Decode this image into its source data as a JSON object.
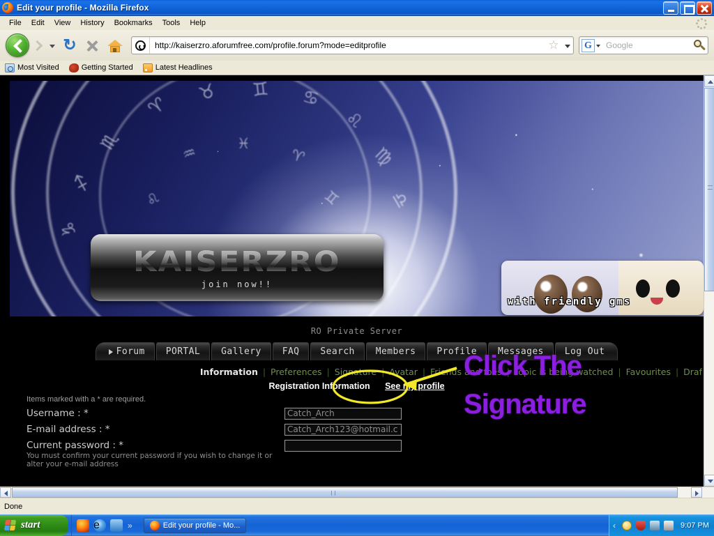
{
  "window": {
    "title": "Edit your profile - Mozilla Firefox",
    "minimize_label": "Minimize",
    "maximize_label": "Restore",
    "close_label": "Close"
  },
  "menubar": {
    "items": [
      {
        "label": "File"
      },
      {
        "label": "Edit"
      },
      {
        "label": "View"
      },
      {
        "label": "History"
      },
      {
        "label": "Bookmarks"
      },
      {
        "label": "Tools"
      },
      {
        "label": "Help"
      }
    ]
  },
  "toolbar": {
    "back_label": "Back",
    "forward_label": "Forward",
    "history_dropdown_label": "Recent pages",
    "reload_glyph": "↻",
    "reload_label": "Reload",
    "stop_label": "Stop",
    "home_label": "Home",
    "url": "http://kaiserzro.aforumfree.com/profile.forum?mode=editprofile",
    "bookmark_star_glyph": "☆",
    "url_dropdown_label": "History dropdown",
    "search_engine_letter": "G",
    "search_placeholder": "Google",
    "search_value": ""
  },
  "bookmarks": {
    "items": [
      {
        "label": "Most Visited",
        "icon": "folder-icon"
      },
      {
        "label": "Getting Started",
        "icon": "dino-icon"
      },
      {
        "label": "Latest Headlines",
        "icon": "rss-icon"
      }
    ]
  },
  "page": {
    "banner": {
      "logo_text": "kaiserzRO",
      "logo_sub": "join now!!",
      "right_banner_text": "with friendly GMs"
    },
    "tagline": "RO Private Server",
    "tabs": [
      {
        "label": "Forum",
        "has_arrow": true
      },
      {
        "label": "PORTAL",
        "has_arrow": false
      },
      {
        "label": "Gallery",
        "has_arrow": false
      },
      {
        "label": "FAQ",
        "has_arrow": false
      },
      {
        "label": "Search",
        "has_arrow": false
      },
      {
        "label": "Members",
        "has_arrow": false
      },
      {
        "label": "Profile",
        "has_arrow": false
      },
      {
        "label": "Messages",
        "has_arrow": false
      },
      {
        "label": "Log Out",
        "has_arrow": false
      }
    ],
    "subnav": {
      "current": "Information",
      "links": [
        "Preferences",
        "Signature",
        "Avatar",
        "Friends and foes",
        "Topic is being watched",
        "Favourites",
        "Draf"
      ],
      "separator": "|"
    },
    "section": {
      "heading": "Registration Information",
      "see_profile_link": "See my profile",
      "required_note": "Items marked with a * are required."
    },
    "form": {
      "fields": [
        {
          "label": "Username : *",
          "sub": "",
          "value": "Catch_Arch",
          "type": "text"
        },
        {
          "label": "E-mail address : *",
          "sub": "",
          "value": "Catch_Arch123@hotmail.c",
          "type": "text"
        },
        {
          "label": "Current password : *",
          "sub": "You must confirm your current password if you wish to change it or alter your e-mail address",
          "value": "",
          "type": "password"
        }
      ]
    },
    "annotations": {
      "line1": "Click The",
      "line2": "Signature",
      "color": "#8b1ee0",
      "highlight_color": "#f2e82a",
      "circle_target": "Signature",
      "arrow_label": "arrow-pointing-to-signature"
    }
  },
  "scrollbars": {
    "vertical_up": "▲",
    "vertical_down": "▼",
    "horizontal_left": "◀",
    "horizontal_right": "▶"
  },
  "statusbar": {
    "text": "Done"
  },
  "taskbar": {
    "start_label": "start",
    "quicklaunch": [
      {
        "name": "firefox-icon"
      },
      {
        "name": "internet-explorer-icon"
      },
      {
        "name": "media-icon"
      }
    ],
    "quicklaunch_chevron": "»",
    "tasks": [
      {
        "label": "Edit your profile - Mo..."
      }
    ],
    "tray_chevron": "‹",
    "tray_icons": [
      {
        "name": "messenger-icon"
      },
      {
        "name": "security-shield-icon"
      },
      {
        "name": "network-icon"
      },
      {
        "name": "volume-icon"
      }
    ],
    "clock": "9:07 PM"
  }
}
